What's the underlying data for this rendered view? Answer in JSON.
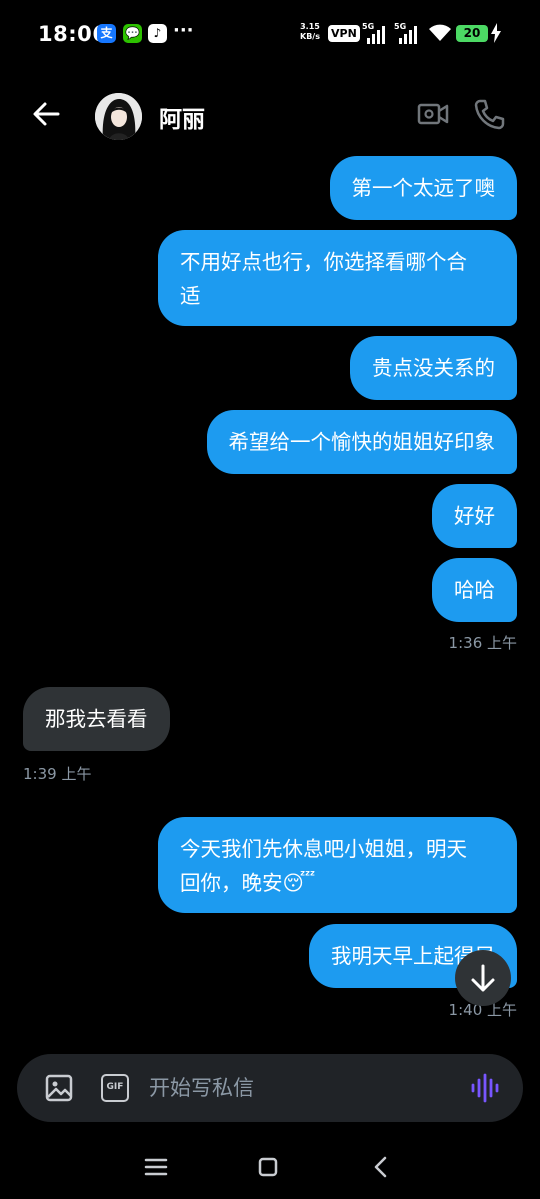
{
  "status_bar": {
    "time": "18:06",
    "apps": [
      "支",
      "💬",
      "♪"
    ],
    "more": "···",
    "speed_value": "3.15",
    "speed_unit": "KB/s",
    "vpn": "VPN",
    "network_1": "5G",
    "network_2": "5G",
    "battery": "20"
  },
  "header": {
    "contact_name": "阿丽"
  },
  "messages": [
    {
      "direction": "out",
      "text": "第一个太远了噢"
    },
    {
      "direction": "out",
      "text": "不用好点也行，你选择看哪个合适"
    },
    {
      "direction": "out",
      "text": "贵点没关系的"
    },
    {
      "direction": "out",
      "text": "希望给一个愉快的姐姐好印象"
    },
    {
      "direction": "out",
      "text": "好好"
    },
    {
      "direction": "out",
      "text": "哈哈"
    },
    {
      "direction": "in",
      "text": "那我去看看"
    },
    {
      "direction": "out",
      "text": "今天我们先休息吧小姐姐，明天回你，晚安😴"
    },
    {
      "direction": "out",
      "text": "我明天早上起得早"
    }
  ],
  "message_lines": {
    "msg2_line1": "不用好点也行，你选择看哪个合",
    "msg2_line2": "适",
    "msg8_line1": "今天我们先休息吧小姐姐，明天",
    "msg8_line2": "回你，晚安😴"
  },
  "timestamps": {
    "t1": "1:36 上午",
    "t2": "1:39 上午",
    "t3": "1:40 上午"
  },
  "composer": {
    "gif_label": "GIF",
    "placeholder": "开始写私信"
  },
  "colors": {
    "background": "#000000",
    "outgoing_bubble": "#1d9bf0",
    "incoming_bubble": "#2f3336",
    "timestamp": "#8b98a5",
    "voice_accent": "#7856ff"
  }
}
